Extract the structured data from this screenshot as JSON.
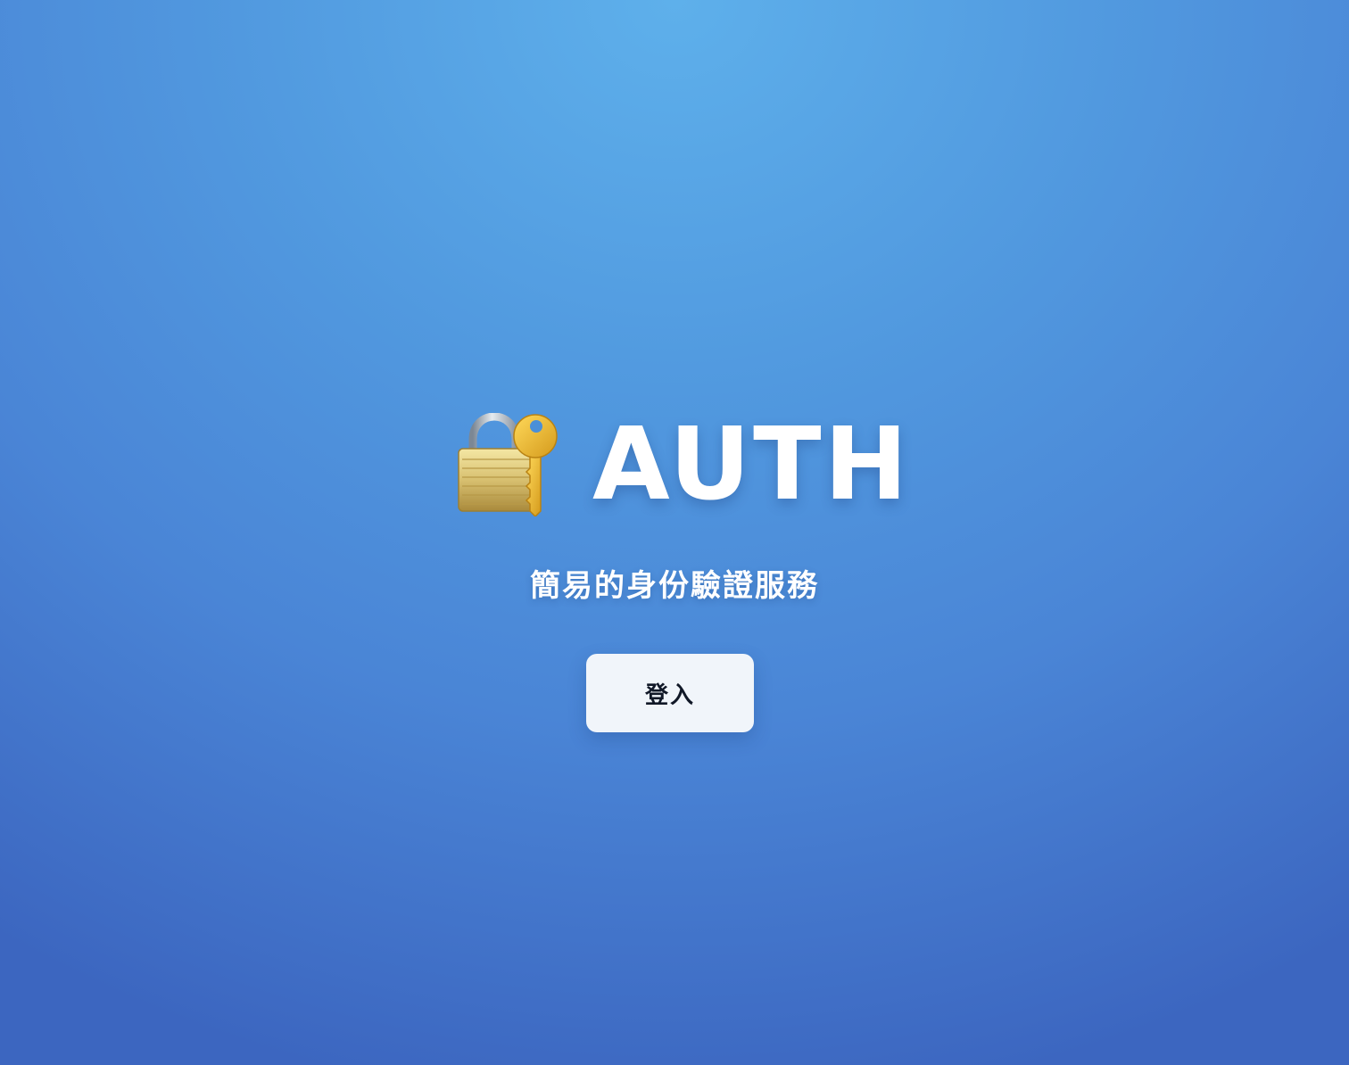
{
  "app": {
    "brand_icon": "lock-with-key-icon",
    "title": "AUTH",
    "subtitle": "簡易的身份驗證服務"
  },
  "actions": {
    "login_label": "登入"
  },
  "colors": {
    "background_top": "#5eb0eb",
    "background_bottom": "#3c66c0",
    "text": "#ffffff",
    "button_bg": "#f1f5fa",
    "button_text": "#111827"
  }
}
